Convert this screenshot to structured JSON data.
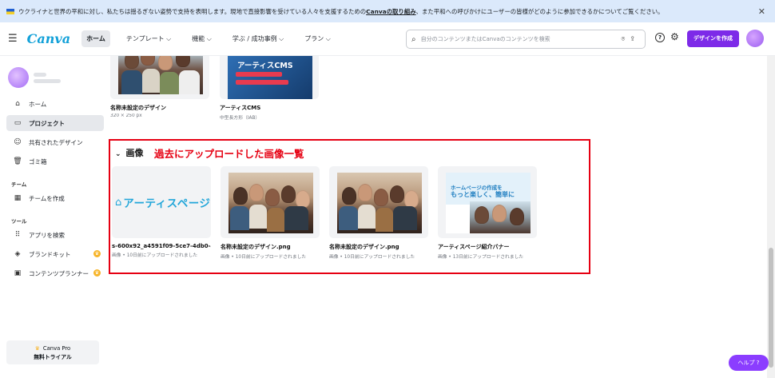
{
  "banner": {
    "text_before": "ウクライナと世界の平和に対し、私たちは揺るぎない姿勢で支持を表明します。現地で直接影響を受けている人々を支援するための",
    "link": "Canvaの取り組み",
    "text_after": "、また平和への呼びかけにユーザーの皆様がどのように参加できるかについてご覧ください。",
    "close": "✕"
  },
  "nav": {
    "logo": "Canva",
    "items": [
      "ホーム",
      "テンプレート ⌵",
      "機能 ⌵",
      "学ぶ / 成功事例 ⌵",
      "プラン ⌵"
    ],
    "search_placeholder": "自分のコンテンツまたはCanvaのコンテンツを検索",
    "create_button": "デザインを作成"
  },
  "sidebar": {
    "items": [
      {
        "icon": "home-icon",
        "glyph": "⌂",
        "label": "ホーム"
      },
      {
        "icon": "folder-icon",
        "glyph": "▭",
        "label": "プロジェクト"
      },
      {
        "icon": "people-icon",
        "glyph": "☺",
        "label": "共有されたデザイン"
      },
      {
        "icon": "trash-icon",
        "glyph": "🗑",
        "label": "ゴミ箱"
      }
    ],
    "team_heading": "チーム",
    "team_items": [
      {
        "icon": "building-icon",
        "glyph": "▦",
        "label": "チームを作成"
      }
    ],
    "tools_heading": "ツール",
    "tool_items": [
      {
        "icon": "apps-icon",
        "glyph": "⠿",
        "label": "アプリを検索",
        "crown": false
      },
      {
        "icon": "brand-kit-icon",
        "glyph": "◈",
        "label": "ブランドキット",
        "crown": true
      },
      {
        "icon": "calendar-icon",
        "glyph": "▣",
        "label": "コンテンツプランナー",
        "crown": true
      }
    ],
    "pro_title": "Canva Pro",
    "pro_subtitle": "無料トライアル"
  },
  "designs": [
    {
      "name": "名称未設定のデザイン",
      "meta": "320 × 250 px"
    },
    {
      "name": "アーティスCMS",
      "meta": "中型長方形（IAB）",
      "thumb_title": "アーティスCMS"
    }
  ],
  "images_section": {
    "title": "画像",
    "annotation": "過去にアップロードした画像一覧",
    "items": [
      {
        "name": "s-600x92_a4591f09-5ce7-4db0-a7...",
        "meta": "画像 • 10日前にアップロードされました",
        "logo_text": "アーティスページ"
      },
      {
        "name": "名称未設定のデザイン.png",
        "meta": "画像 • 10日前にアップロードされました"
      },
      {
        "name": "名称未設定のデザイン.png",
        "meta": "画像 • 10日前にアップロードされました"
      },
      {
        "name": "アーティスページ紹介バナー",
        "meta": "画像 • 13日前にアップロードされました",
        "banner_line1": "ホームページの作成を",
        "banner_line2": "もっと楽しく、簡単に"
      }
    ]
  },
  "help_button": "ヘルプ ?"
}
